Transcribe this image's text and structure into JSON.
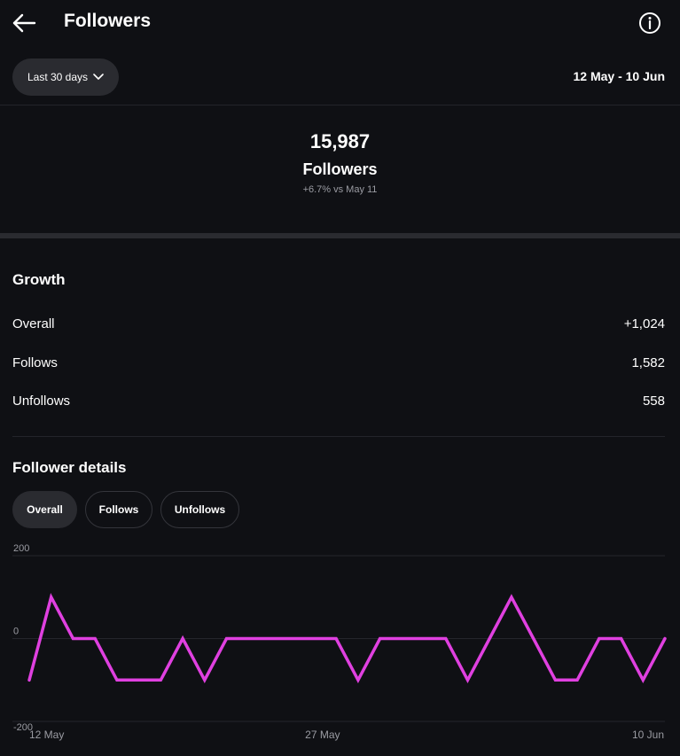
{
  "header": {
    "title": "Followers"
  },
  "filters": {
    "range_label": "Last 30 days",
    "date_range": "12 May - 10 Jun"
  },
  "summary": {
    "count": "15,987",
    "label": "Followers",
    "change": "+6.7% vs May 11"
  },
  "growth": {
    "title": "Growth",
    "rows": [
      {
        "label": "Overall",
        "value": "+1,024"
      },
      {
        "label": "Follows",
        "value": "1,582"
      },
      {
        "label": "Unfollows",
        "value": "558"
      }
    ]
  },
  "details": {
    "title": "Follower details",
    "tabs": [
      "Overall",
      "Follows",
      "Unfollows"
    ],
    "active_tab": "Overall"
  },
  "colors": {
    "line": "#e040e0",
    "background": "#0f1014"
  },
  "chart_data": {
    "type": "line",
    "x_tick_labels": [
      "12 May",
      "27 May",
      "10 Jun"
    ],
    "y_tick_labels": [
      "200",
      "0",
      "-200"
    ],
    "ylim": [
      -200,
      200
    ],
    "grid": true,
    "series": [
      {
        "values": [
          -100,
          100,
          0,
          0,
          -100,
          -100,
          -100,
          0,
          -100,
          0,
          0,
          0,
          0,
          0,
          0,
          -100,
          0,
          0,
          0,
          0,
          -100,
          0,
          100,
          0,
          -100,
          -100,
          0,
          0,
          -100,
          0
        ]
      }
    ]
  }
}
